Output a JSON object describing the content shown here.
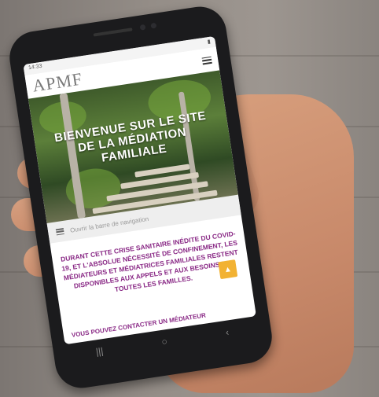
{
  "phone": {
    "status_time": "14:33",
    "site": {
      "logo_text": "APMF",
      "hero_title_lines": [
        "BIENVENUE SUR LE SITE",
        "DE LA MÉDIATION",
        "FAMILIALE"
      ],
      "nav_label": "Ouvrir la barre de navigation",
      "covid_text": "DURANT CETTE CRISE SANITAIRE INÉDITE DU COVID-19, ET L'ABSOLUE NÉCESSITÉ DE CONFINEMENT, LES MÉDIATEURS ET MÉDIATRICES FAMILIALES RESTENT DISPONIBLES AUX APPELS ET AUX BESOINS DE TOUTES LES FAMILLES.",
      "contact_text": "VOUS POUVEZ CONTACTER UN MÉDIATEUR",
      "colors": {
        "accent": "#8a2a86",
        "fab": "#f2b233"
      }
    },
    "system_nav": {
      "recent": "|||",
      "home": "○",
      "back": "‹"
    }
  }
}
